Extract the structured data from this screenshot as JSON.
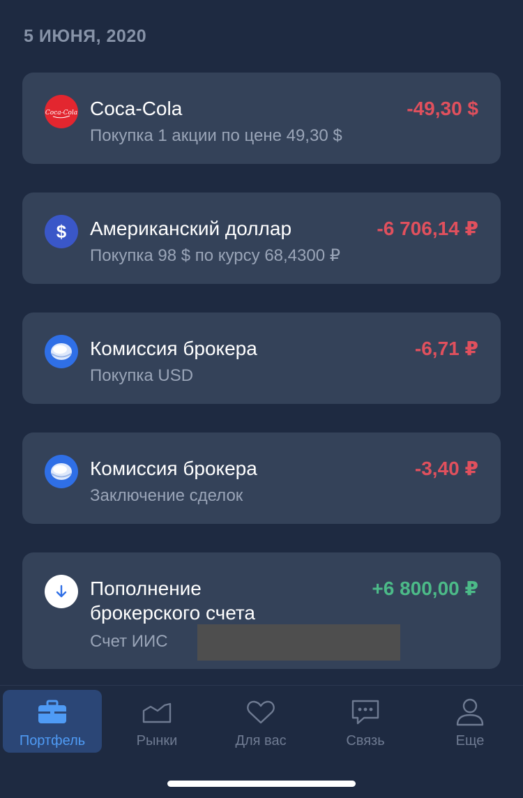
{
  "date_header": "5 ИЮНЯ, 2020",
  "operations": [
    {
      "icon": "coca-cola-logo-icon",
      "logo_text": "Coca-Cola",
      "title": "Coca-Cola",
      "subtitle": "Покупка 1 акции по цене 49,30 $",
      "amount": "-49,30 $",
      "amount_color": "#e0505d"
    },
    {
      "icon": "dollar-icon",
      "icon_glyph": "$",
      "title": "Американский доллар",
      "subtitle": "Покупка 98 $ по курсу 68,4300 ₽",
      "amount": "-6 706,14 ₽",
      "amount_color": "#e0505d"
    },
    {
      "icon": "broker-commission-icon",
      "title": "Комиссия брокера",
      "subtitle": "Покупка USD",
      "amount": "-6,71 ₽",
      "amount_color": "#e0505d"
    },
    {
      "icon": "broker-commission-icon",
      "title": "Комиссия брокера",
      "subtitle": "Заключение сделок",
      "amount": "-3,40 ₽",
      "amount_color": "#e0505d"
    },
    {
      "icon": "arrow-down-icon",
      "title_line1": "Пополнение",
      "title_line2": "брокерского счета",
      "subtitle": "Счет ИИС",
      "amount": "+6 800,00 ₽",
      "amount_color": "#4cba88"
    }
  ],
  "tabs": [
    {
      "label": "Портфель",
      "icon": "briefcase-icon",
      "active": true
    },
    {
      "label": "Рынки",
      "icon": "markets-chart-icon",
      "active": false
    },
    {
      "label": "Для вас",
      "icon": "heart-icon",
      "active": false
    },
    {
      "label": "Связь",
      "icon": "chat-bubble-icon",
      "active": false
    },
    {
      "label": "Еще",
      "icon": "profile-icon",
      "active": false
    }
  ],
  "colors": {
    "background": "#1e2a41",
    "card": "#344259",
    "negative": "#e0505d",
    "positive": "#4cba88",
    "active_tab": "#4f9bf5"
  }
}
